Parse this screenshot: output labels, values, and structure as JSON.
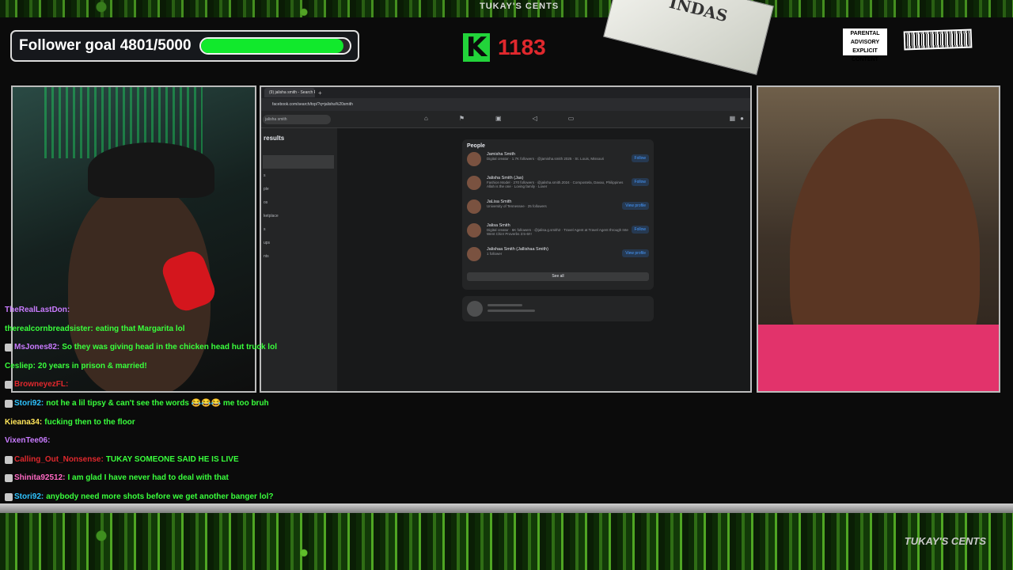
{
  "overlay": {
    "brand_top": "TUKAY'S CENTS",
    "brand_bottom": "TUKAY'S CENTS",
    "bill_text": "INDAS",
    "advisory_text": "PARENTAL ADVISORY EXPLICIT CONTENT",
    "follower_goal": {
      "label": "Follower goal 4801/5000",
      "current": 4801,
      "target": 5000,
      "progress_fraction": 0.96,
      "fill_color": "#11e92c"
    },
    "kick": {
      "logo": "K",
      "count": "1183",
      "logo_color": "#22d43a",
      "count_color": "#e0282d"
    }
  },
  "browser": {
    "tab_title": "(9) jalisha smith - Search Re...",
    "new_tab": "+",
    "url": "facebook.com/search/top/?q=jalisha%20smith",
    "search_value": "jalisha smith",
    "left_panel": {
      "title": "results",
      "items": [
        "",
        "",
        "s",
        "ple",
        "os",
        "ketplace",
        "s",
        "ups",
        "nts"
      ]
    },
    "people": {
      "title": "People",
      "rows": [
        {
          "name": "Jamisha Smith",
          "sub1": "Digital creator · 1.7K followers · @jamisha.smith 2025 · St. Louis, Missouri",
          "sub2": "",
          "button": "Follow"
        },
        {
          "name": "Jalisha Smith (Jas)",
          "sub1": "Fashion Model · 270 followers · @jalisha.smith.2024 · Compostela, Davao, Philippines",
          "sub2": "Allah is the one · Loving family · Lover",
          "button": "Follow"
        },
        {
          "name": "JaLisa Smith",
          "sub1": "University of Tennessee · 25 followers",
          "sub2": "",
          "button": "View profile"
        },
        {
          "name": "Jalisa Smith",
          "sub1": "Digital creator · 6K followers · @jalisa.g.smith2 · Travel Agent at Travel Agent through International Vacations",
          "sub2": "Went Chin! Proverbs 3:5-6!!!",
          "button": "Follow"
        },
        {
          "name": "Jalishaa Smith (Jallishaa Smith)",
          "sub1": "1 follower",
          "sub2": "",
          "button": "View profile"
        }
      ],
      "see_all": "See all"
    }
  },
  "chat": [
    {
      "badge": false,
      "user": "TheRealLastDon:",
      "user_color": "#c97bff",
      "text": ""
    },
    {
      "badge": false,
      "user": "therealcornbreadsister:",
      "user_color": "#39ff3c",
      "text": "eating that Margarita lol"
    },
    {
      "badge": true,
      "user": "MsJones82:",
      "user_color": "#c97bff",
      "text": "So they was giving head in the chicken head hut truck lol"
    },
    {
      "badge": false,
      "user": "Cesliep:",
      "user_color": "#39ff3c",
      "text": "20 years in prison & married!"
    },
    {
      "badge": true,
      "user": "BrowneyezFL:",
      "user_color": "#e0282d",
      "text": ""
    },
    {
      "badge": true,
      "user": "Stori92:",
      "user_color": "#2ec3ff",
      "text": "not he a lil tipsy & can't see the words 😂😂😂 me too bruh"
    },
    {
      "badge": false,
      "user": "Kieana34:",
      "user_color": "#ffe55a",
      "text": "fucking then to the floor"
    },
    {
      "badge": false,
      "user": "VixenTee06:",
      "user_color": "#c97bff",
      "text": ""
    },
    {
      "badge": true,
      "user": "Calling_Out_Nonsense:",
      "user_color": "#e0282d",
      "text": "TUKAY SOMEONE SAID HE IS LIVE"
    },
    {
      "badge": true,
      "user": "Shinita92512:",
      "user_color": "#ff69c4",
      "text": "I am glad I have never had to deal with that"
    },
    {
      "badge": true,
      "user": "Stori92:",
      "user_color": "#2ec3ff",
      "text": "anybody need more shots before we get another banger lol?"
    }
  ]
}
